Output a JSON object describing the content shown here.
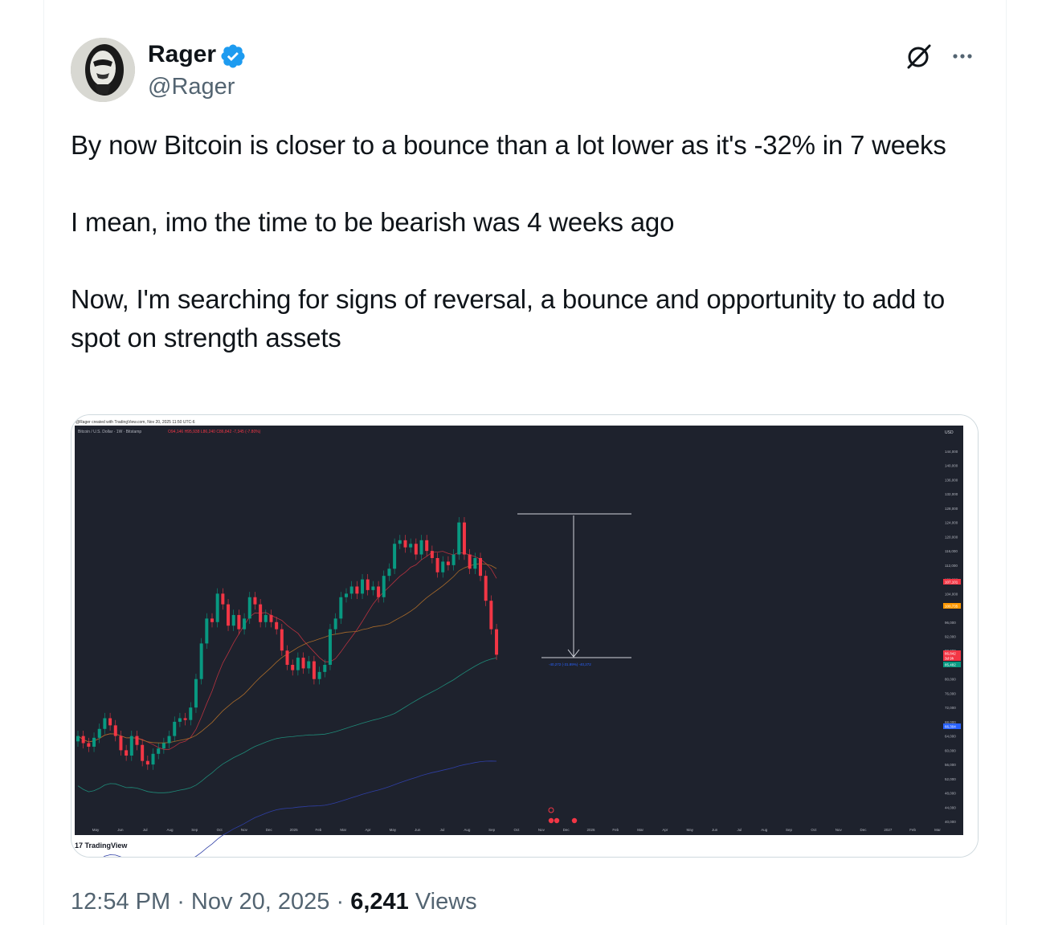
{
  "author": {
    "name": "Rager",
    "handle": "@Rager",
    "verified_color": "#1d9bf0"
  },
  "tweet": {
    "text": "By now Bitcoin is closer to a bounce than a lot lower as it's -32% in 7 weeks\n\nI mean, imo the time to be bearish was 4 weeks ago\n\nNow, I'm searching for signs of reversal, a bounce and opportunity to add to spot on strength assets"
  },
  "actions": {
    "grok_icon": "grok-icon",
    "more_icon": "more-icon"
  },
  "meta": {
    "time": "12:54 PM",
    "sep1": " · ",
    "date": "Nov 20, 2025",
    "sep2": " · ",
    "views": "6,241",
    "views_label": " Views"
  },
  "chart_header": {
    "created": "@Rager created with TradingView.com, Nov 20, 2025 11:50 UTC-6",
    "symbol": "Bitcoin / U.S. Dollar · 1W · Bitstamp",
    "ohlc": "O94,146 H95,938 L86,240 C86,842 -7,345 (-7.80%)",
    "watermark": "TradingView"
  },
  "chart_data": {
    "type": "candlestick",
    "currency": "USD",
    "y_ticks": [
      "144,000",
      "140,000",
      "136,000",
      "132,000",
      "128,000",
      "124,000",
      "120,000",
      "116,000",
      "112,000",
      "108,000",
      "104,000",
      "96,000",
      "92,000",
      "88,000",
      "80,000",
      "76,000",
      "72,000",
      "68,000",
      "64,000",
      "60,000",
      "56,000",
      "52,000",
      "48,000",
      "44,000",
      "40,000"
    ],
    "x_ticks": [
      "May",
      "Jun",
      "Jul",
      "Aug",
      "Sep",
      "Oct",
      "Nov",
      "Dec",
      "2025",
      "Feb",
      "Mar",
      "Apr",
      "May",
      "Jun",
      "Jul",
      "Aug",
      "Sep",
      "Oct",
      "Nov",
      "Dec",
      "2026",
      "Feb",
      "Mar",
      "Apr",
      "May",
      "Jun",
      "Jul",
      "Aug",
      "Sep",
      "Oct",
      "Nov",
      "Dec",
      "2027",
      "Feb",
      "Mar"
    ],
    "price_labels": [
      {
        "text": "107,101",
        "color": "#f23645"
      },
      {
        "text": "100,735",
        "color": "#ff9800"
      },
      {
        "text": "86,842",
        "color": "#f23645"
      },
      {
        "text": "3d 9h",
        "color": "#f23645"
      },
      {
        "text": "85,482",
        "color": "#089981"
      },
      {
        "text": "66,304",
        "color": "#2962ff"
      }
    ],
    "measure_label": "-40,272 (-31.89%) -40,272",
    "ylim": [
      40000,
      148000
    ]
  }
}
